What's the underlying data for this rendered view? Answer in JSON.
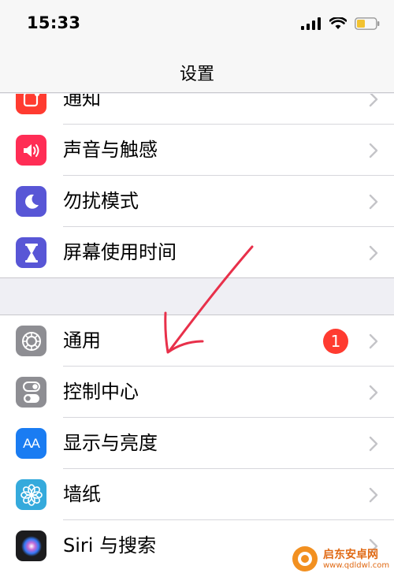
{
  "status": {
    "time": "15:33"
  },
  "nav": {
    "title": "设置"
  },
  "group1": [
    {
      "label": "通知",
      "icon": "notification-icon",
      "color": "#ff3b30"
    },
    {
      "label": "声音与触感",
      "icon": "speaker-icon",
      "color": "#ff2d55"
    },
    {
      "label": "勿扰模式",
      "icon": "moon-icon",
      "color": "#5856d6"
    },
    {
      "label": "屏幕使用时间",
      "icon": "hourglass-icon",
      "color": "#5856d6"
    }
  ],
  "group2": [
    {
      "label": "通用",
      "icon": "gear-icon",
      "color": "#8e8e93",
      "badge": "1"
    },
    {
      "label": "控制中心",
      "icon": "toggle-icon",
      "color": "#8e8e93"
    },
    {
      "label": "显示与亮度",
      "icon": "text-size-icon",
      "color": "#1a7cf2",
      "glyph": "AA"
    },
    {
      "label": "墙纸",
      "icon": "flower-icon",
      "color": "#35aadc"
    },
    {
      "label": "Siri 与搜索",
      "icon": "siri-icon",
      "color": "#1c1c1e"
    }
  ],
  "watermark": {
    "name": "启东安卓网",
    "url": "www.qdldwl.com"
  }
}
